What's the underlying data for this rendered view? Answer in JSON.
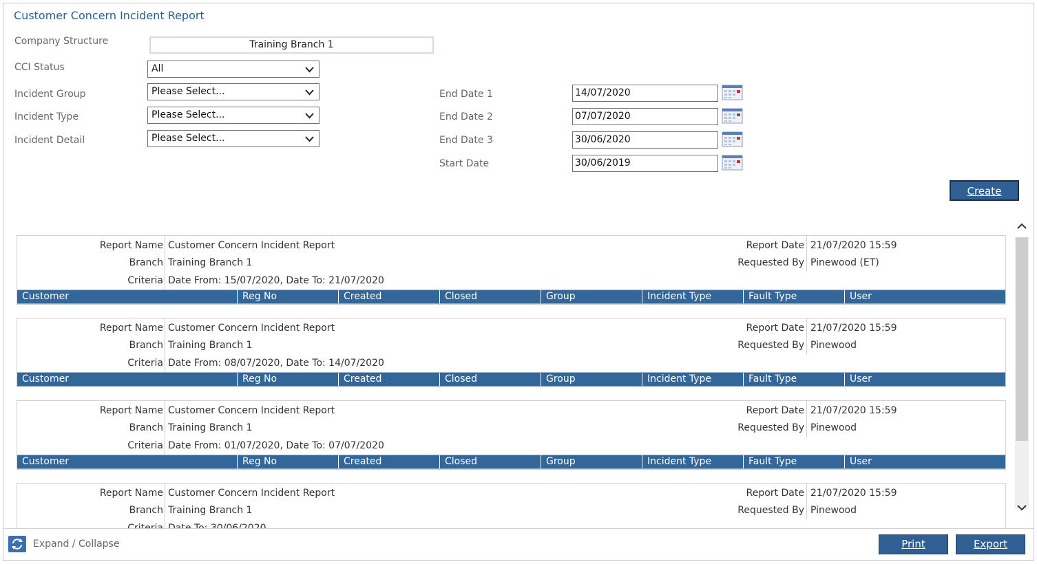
{
  "title": "Customer Concern Incident Report",
  "filters": {
    "company_structure_label": "Company Structure",
    "company_structure_value": "Training Branch 1",
    "cci_status_label": "CCI Status",
    "cci_status_value": "All",
    "incident_group_label": "Incident Group",
    "incident_group_value": "Please Select...",
    "incident_type_label": "Incident Type",
    "incident_type_value": "Please Select...",
    "incident_detail_label": "Incident Detail",
    "incident_detail_value": "Please Select...",
    "end_date_1_label": "End Date 1",
    "end_date_1_value": "14/07/2020",
    "end_date_2_label": "End Date 2",
    "end_date_2_value": "07/07/2020",
    "end_date_3_label": "End Date 3",
    "end_date_3_value": "30/06/2020",
    "start_date_label": "Start Date",
    "start_date_value": "30/06/2019"
  },
  "buttons": {
    "create": "Create",
    "print": "Print",
    "export": "Export",
    "expand_collapse": "Expand / Collapse"
  },
  "labels": {
    "report_name": "Report Name",
    "branch": "Branch",
    "criteria": "Criteria",
    "report_date": "Report Date",
    "requested_by": "Requested By"
  },
  "columns": [
    "Customer",
    "Reg No",
    "Created",
    "Closed",
    "Group",
    "Incident Type",
    "Fault Type",
    "User"
  ],
  "reports": [
    {
      "report_name": "Customer Concern Incident Report",
      "branch": "Training Branch 1",
      "criteria": "Date From: 15/07/2020, Date To: 21/07/2020",
      "report_date": "21/07/2020 15:59",
      "requested_by": "Pinewood (ET)"
    },
    {
      "report_name": "Customer Concern Incident Report",
      "branch": "Training Branch 1",
      "criteria": "Date From: 08/07/2020, Date To: 14/07/2020",
      "report_date": "21/07/2020 15:59",
      "requested_by": "Pinewood"
    },
    {
      "report_name": "Customer Concern Incident Report",
      "branch": "Training Branch 1",
      "criteria": "Date From: 01/07/2020, Date To: 07/07/2020",
      "report_date": "21/07/2020 15:59",
      "requested_by": "Pinewood"
    },
    {
      "report_name": "Customer Concern Incident Report",
      "branch": "Training Branch 1",
      "criteria": "Date To: 30/06/2020",
      "report_date": "21/07/2020 15:59",
      "requested_by": "Pinewood"
    }
  ],
  "colors": {
    "header_blue": "#336699",
    "button_blue": "#2f5f93",
    "title_blue": "#2b5f8e"
  }
}
